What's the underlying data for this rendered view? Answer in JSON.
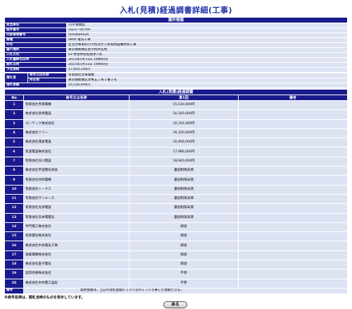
{
  "page_title": "入札(見積)経過調書詳細(工事)",
  "case_info": {
    "header": "案件情報",
    "rows": [
      {
        "label": "担当係名",
        "value": "119 板橋区"
      },
      {
        "label": "案件番号",
        "value": "2023－00709"
      },
      {
        "label": "内部管理番号",
        "value": "5050800026"
      },
      {
        "label": "業種",
        "value": "0800 電気工事"
      },
      {
        "label": "件名",
        "value": "区立赤塚第四小学校ほか１校照明設備改修工事"
      },
      {
        "label": "履行場所",
        "value": "東京都板橋区各学校所在地"
      },
      {
        "label": "入札方式",
        "value": "03 希望制指名競争入札"
      },
      {
        "label": "入札書締切日時",
        "value": "2023年5月31日 10時00分"
      },
      {
        "label": "開札日時",
        "value": "2023年5月31日 10時40分"
      },
      {
        "label": "予定価格",
        "value": "17,854,100円"
      }
    ],
    "winner_label": "落札者",
    "winner_name_label": "商号又は名称",
    "winner_name": "有限会社赤塚電機",
    "winner_addr_label": "所在地",
    "winner_addr": "東京都板橋区赤塚五丁目１番２号",
    "amount_label": "落札金額",
    "amount": "15,530,000円"
  },
  "bid_table": {
    "header": "入札(見積)経過調書",
    "col_no": "No",
    "col_name": "商号又は名称",
    "col_round": "第1回",
    "col_remarks": "備考",
    "rows": [
      {
        "no": "1",
        "name": "有限会社赤塚電機",
        "amount": "15,530,000円"
      },
      {
        "no": "2",
        "name": "株式会社高崎電設",
        "amount": "16,160,000円"
      },
      {
        "no": "3",
        "name": "ゴーテック株式会社",
        "amount": "16,192,000円"
      },
      {
        "no": "4",
        "name": "株式会社ツリー",
        "amount": "16,320,000円"
      },
      {
        "no": "5",
        "name": "株式会社城倉電設",
        "amount": "16,460,000円"
      },
      {
        "no": "6",
        "name": "筑波電設株式会社",
        "amount": "17,986,000円"
      },
      {
        "no": "7",
        "name": "有限会社日川電設",
        "amount": "18,940,000円"
      },
      {
        "no": "8",
        "name": "株式会社平田電気商会",
        "amount": "最低制限未満"
      },
      {
        "no": "9",
        "name": "有限会社共同電機",
        "amount": "最低制限未満"
      },
      {
        "no": "10",
        "name": "有限会社トークス",
        "amount": "最低制限未満"
      },
      {
        "no": "11",
        "name": "有限会社サンエース",
        "amount": "最低制限未満"
      },
      {
        "no": "12",
        "name": "有限会社光栄電設",
        "amount": "最低制限未満"
      },
      {
        "no": "13",
        "name": "有限会社日本電電気",
        "amount": "最低制限未満"
      },
      {
        "no": "14",
        "name": "寺門電工株式会社",
        "amount": "辞退"
      },
      {
        "no": "15",
        "name": "高栄電気株式会社",
        "amount": "辞退"
      },
      {
        "no": "16",
        "name": "株式会社中谷電気工事",
        "amount": "辞退"
      },
      {
        "no": "17",
        "name": "璃尾電機株式会社",
        "amount": "辞退"
      },
      {
        "no": "18",
        "name": "株式会社金子電気",
        "amount": "辞退"
      },
      {
        "no": "19",
        "name": "美和商事株式会社",
        "amount": "不参"
      },
      {
        "no": "20",
        "name": "株式会社木村電工設段",
        "amount": "不参"
      }
    ],
    "note_label": "備考",
    "note_text": "契約金額は、上記の落札金額に１００分の１１０を乗じた金額となる。"
  },
  "footnote": "※商号名称は、開札当時のものを表示しています。",
  "back_button": "戻る"
}
